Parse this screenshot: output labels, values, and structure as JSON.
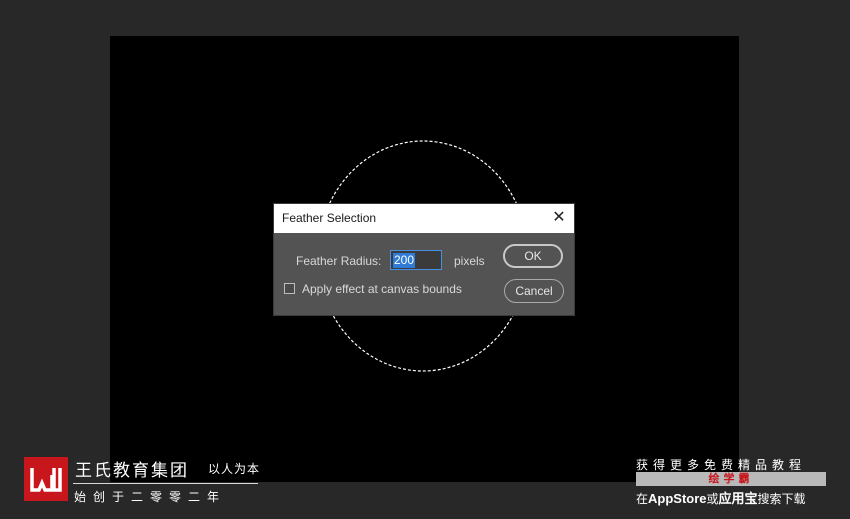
{
  "dialog": {
    "title": "Feather Selection",
    "close_glyph": "✕",
    "feather_radius_label": "Feather Radius:",
    "feather_radius_value": "200",
    "unit_label": "pixels",
    "apply_label": "Apply effect at canvas bounds",
    "apply_checked": false,
    "ok_label": "OK",
    "cancel_label": "Cancel"
  },
  "watermark_left": {
    "name": "王氏教育集团",
    "slogan": "以人为本",
    "year": "始创于二零零二年"
  },
  "watermark_right": {
    "line1": "获得更多免费精品教程",
    "bar_text": "绘学霸",
    "line3_prefix": "在",
    "store1": "AppStore",
    "line3_mid": "或",
    "store2": "应用宝",
    "line3_suffix": "搜索下载"
  },
  "colors": {
    "accent": "#2f7bd6",
    "brand_red": "#c8161d"
  },
  "icons": [
    "close-icon",
    "checkbox-icon",
    "wangshi-logo-icon"
  ]
}
